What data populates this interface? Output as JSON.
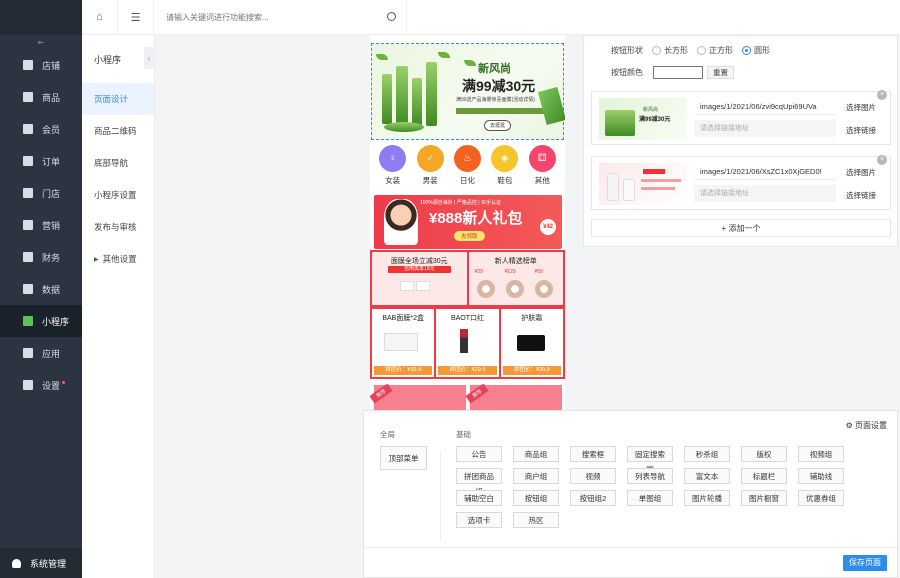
{
  "sidebar": {
    "items": [
      {
        "label": "店铺",
        "icon": "store-icon"
      },
      {
        "label": "商品",
        "icon": "goods-icon"
      },
      {
        "label": "会员",
        "icon": "member-icon"
      },
      {
        "label": "订单",
        "icon": "order-icon"
      },
      {
        "label": "门店",
        "icon": "shop-icon"
      },
      {
        "label": "营销",
        "icon": "marketing-icon"
      },
      {
        "label": "财务",
        "icon": "finance-icon"
      },
      {
        "label": "数据",
        "icon": "data-icon"
      },
      {
        "label": "小程序",
        "icon": "miniapp-icon"
      },
      {
        "label": "应用",
        "icon": "apps-icon"
      },
      {
        "label": "设置",
        "icon": "settings-icon"
      }
    ],
    "active_index": 8,
    "bottom_label": "系统管理"
  },
  "topbar": {
    "search_placeholder": "请输入关键词进行功能搜索..."
  },
  "submenu": {
    "title": "小程序",
    "items": [
      "页面设计",
      "商品二维码",
      "底部导航",
      "小程序设置",
      "发布与审核",
      "其他设置"
    ],
    "active_index": 0
  },
  "phone": {
    "banner": {
      "title": "新风尚",
      "headline": "满99减30元",
      "subline": "满99送产品海量惊喜面膜(活动详情)",
      "button": "去逛逛"
    },
    "categories": [
      {
        "label": "女装",
        "color": "#8e7cf2",
        "glyph": "♀"
      },
      {
        "label": "男装",
        "color": "#f5a623",
        "glyph": "♂"
      },
      {
        "label": "日化",
        "color": "#f5611f",
        "glyph": "♨"
      },
      {
        "label": "鞋包",
        "color": "#f7c52b",
        "glyph": "◈"
      },
      {
        "label": "其他",
        "color": "#f2466a",
        "glyph": "⚃"
      }
    ],
    "promo": {
      "top": "100%源自海外 | 严格品控 | 买手认证",
      "headline": "¥888新人礼包",
      "button": "去领取",
      "tag": "¥42"
    },
    "row2": [
      {
        "title": "面膜全场立减30元",
        "pill": "自用再享18元"
      },
      {
        "title": "新人精选榜单",
        "prices": [
          "¥29",
          "¥129",
          "¥59"
        ]
      }
    ],
    "row3": [
      {
        "title": "BAB面膜*2盒",
        "price": "拼团价：¥39.9"
      },
      {
        "title": "BAOT口红",
        "price": "拼团价：¥29.9"
      },
      {
        "title": "护肤霜",
        "price": "拼团价：¥29.9"
      }
    ],
    "row4_corner": "推荐"
  },
  "panel": {
    "shape_label": "按钮形状",
    "shapes": [
      "长方形",
      "正方形",
      "圆形"
    ],
    "selected_shape": 2,
    "color_label": "按钮颜色",
    "reset_label": "重置",
    "images": [
      {
        "path": "images/1/2021/06/zvi9cqUpi69UVa",
        "link_placeholder": "请选择链接地址",
        "choose_image": "选择图片",
        "choose_link": "选择链接"
      },
      {
        "path": "images/1/2021/06/XsZC1x0XjGED0!",
        "link_placeholder": "请选择链接地址",
        "choose_image": "选择图片",
        "choose_link": "选择链接"
      }
    ],
    "add_more": "添加一个"
  },
  "library": {
    "global_label": "全局",
    "basic_label": "基础",
    "page_settings": "页面设置",
    "global_items": [
      "顶部菜单"
    ],
    "basic_items": [
      "公告",
      "商品组",
      "搜索框",
      "固定搜索框",
      "秒杀组",
      "版权",
      "视频组",
      "拼团商品组",
      "商户组",
      "视频",
      "列表导航",
      "富文本",
      "标题栏",
      "辅助线",
      "辅助空白",
      "按钮组",
      "按钮组2",
      "单图组",
      "图片轮播",
      "图片橱窗",
      "优惠券组",
      "选项卡",
      "热区"
    ],
    "save_label": "保存页面"
  }
}
